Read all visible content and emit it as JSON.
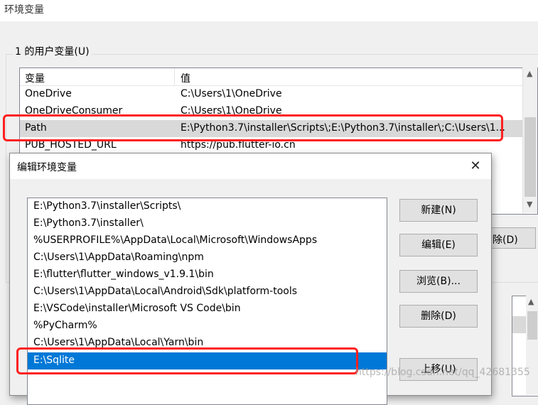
{
  "window": {
    "title": "环境变量"
  },
  "user_vars": {
    "group_label": "1 的用户变量(U)",
    "columns": [
      "变量",
      "值"
    ],
    "rows": [
      {
        "name": "OneDrive",
        "value": "C:\\Users\\1\\OneDrive"
      },
      {
        "name": "OneDriveConsumer",
        "value": "C:\\Users\\1\\OneDrive"
      },
      {
        "name": "Path",
        "value": "E:\\Python3.7\\installer\\Scripts\\;E:\\Python3.7\\installer\\;C:\\Users\\1..."
      },
      {
        "name": "PUB_HOSTED_URL",
        "value": "https://pub.flutter-io.cn"
      }
    ],
    "delete_partial": "除(D)"
  },
  "dialog": {
    "title": "编辑环境变量",
    "close_glyph": "✕",
    "paths": [
      "E:\\Python3.7\\installer\\Scripts\\",
      "E:\\Python3.7\\installer\\",
      "%USERPROFILE%\\AppData\\Local\\Microsoft\\WindowsApps",
      "C:\\Users\\1\\AppData\\Roaming\\npm",
      "E:\\flutter\\flutter_windows_v1.9.1\\bin",
      "C:\\Users\\1\\AppData\\Local\\Android\\Sdk\\platform-tools",
      "E:\\VSCode\\installer\\Microsoft VS Code\\bin",
      "%PyCharm%",
      "C:\\Users\\1\\AppData\\Local\\Yarn\\bin",
      "E:\\Sqlite"
    ],
    "buttons": {
      "new": "新建(N)",
      "edit": "编辑(E)",
      "browse": "浏览(B)...",
      "delete": "删除(D)",
      "move_up": "上移(U)"
    }
  },
  "watermark": "https://blog.csdn.net/qq_42681355",
  "colors": {
    "selection": "#0078d7",
    "highlight_box": "#ff2020"
  }
}
